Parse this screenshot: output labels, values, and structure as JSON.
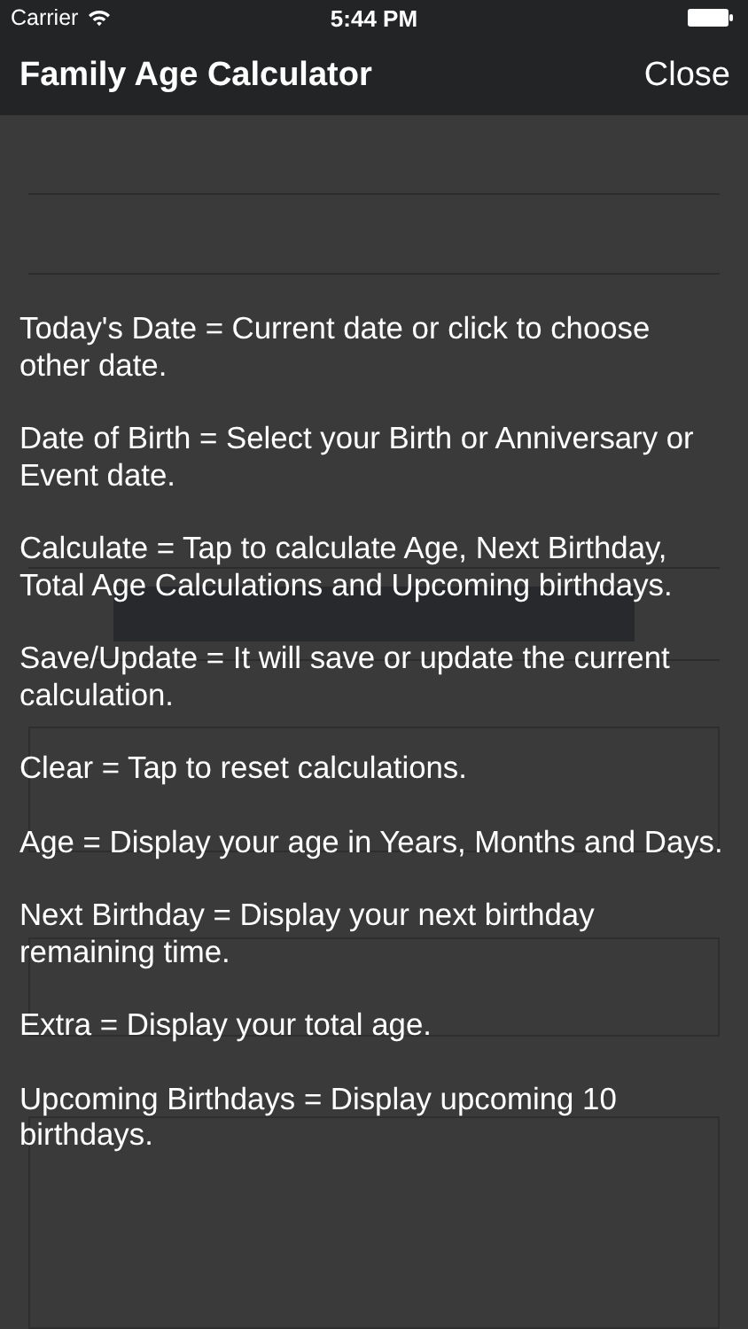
{
  "status_bar": {
    "carrier": "Carrier",
    "time": "5:44 PM"
  },
  "nav": {
    "title": "Family Age Calculator",
    "close": "Close"
  },
  "help": [
    "Today's Date = Current date or click to choose other date.",
    "Date of Birth = Select your Birth or Anniversary or Event date.",
    "Calculate = Tap to calculate Age, Next Birthday, Total Age Calculations and Upcoming birthdays.",
    "Save/Update = It will save or update the current calculation.",
    "Clear = Tap to reset calculations.",
    "Age = Display your age in Years, Months and Days.",
    "Next Birthday = Display your next birthday remaining time.",
    "Extra = Display your total age.",
    "Upcoming Birthdays = Display upcoming 10 birthdays."
  ]
}
